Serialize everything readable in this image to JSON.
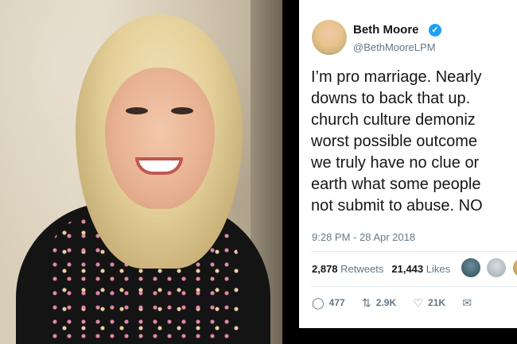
{
  "tweet": {
    "name": "Beth Moore",
    "verified_icon": "verified-badge-icon",
    "handle": "@BethMooreLPM",
    "lines": [
      "I’m pro marriage. Nearly",
      "downs to back that up.",
      "church culture demoniz",
      "worst possible outcome",
      "we truly have no clue or",
      "earth what some people",
      "not submit to abuse. NO"
    ],
    "timestamp": "9:28 PM - 28 Apr 2018",
    "stats": {
      "retweets_value": "2,878",
      "retweets_label": "Retweets",
      "likes_value": "21,443",
      "likes_label": "Likes"
    },
    "actions": {
      "reply_icon": "reply-icon",
      "reply_count": "477",
      "retweet_icon": "retweet-icon",
      "retweet_count": "2.9K",
      "like_icon": "heart-icon",
      "like_count": "21K",
      "dm_icon": "envelope-icon"
    }
  },
  "colors": {
    "text": "#14171a",
    "secondary": "#657786",
    "verified": "#1da1f2",
    "divider": "#e1e8ed",
    "background": "#000000"
  }
}
